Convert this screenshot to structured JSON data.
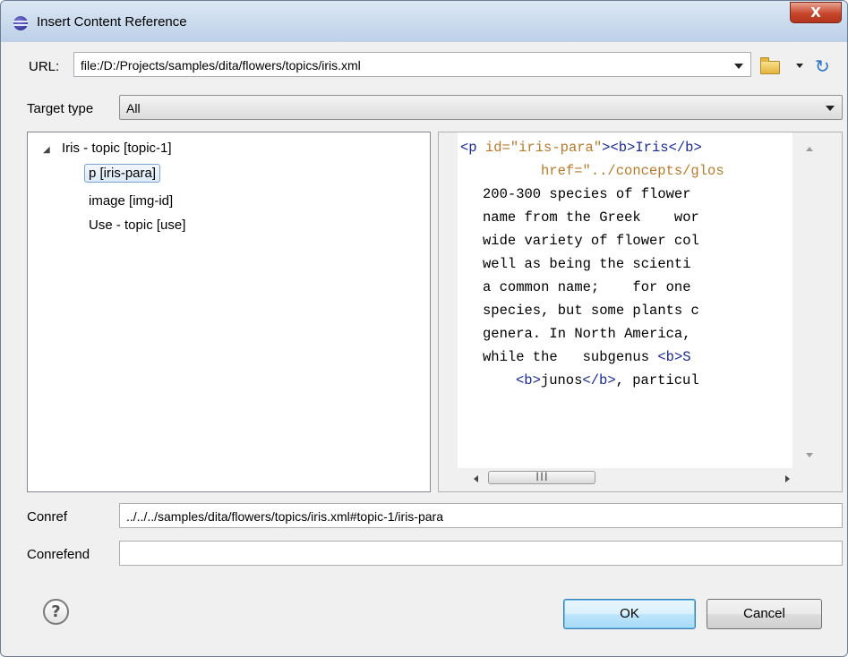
{
  "window": {
    "title": "Insert Content Reference",
    "close_glyph": "X"
  },
  "url": {
    "label": "URL:",
    "value": "file:/D:/Projects/samples/dita/flowers/topics/iris.xml"
  },
  "target_type": {
    "label": "Target type",
    "value": "All"
  },
  "tree": {
    "root": "Iris - topic [topic-1]",
    "children": [
      "p [iris-para]",
      "image [img-id]",
      "Use - topic [use]"
    ],
    "selected": "p [iris-para]"
  },
  "preview": {
    "line1": {
      "tag_open": "<p",
      "attr": " id=",
      "val": "\"iris-para\"",
      "rest": "><b>Iris</b> "
    },
    "line2": {
      "attr": "href=",
      "val": "\"../concepts/glos"
    },
    "lines": [
      "200-300 species of flower",
      "name from the Greek    wor",
      "wide variety of flower col",
      "well as being the scienti",
      "a common name;    for one ",
      "species, but some plants c",
      "genera. In North America, "
    ],
    "line10": {
      "text": "while the   subgenus ",
      "tag": "<b>S"
    },
    "line11": {
      "tag_open": "<b>",
      "text": "junos",
      "tag_close": "</b>",
      "rest": ", particul"
    }
  },
  "conref": {
    "label": "Conref",
    "value": "../../../samples/dita/flowers/topics/iris.xml#topic-1/iris-para"
  },
  "conrefend": {
    "label": "Conrefend",
    "value": ""
  },
  "buttons": {
    "help": "?",
    "ok": "OK",
    "cancel": "Cancel"
  },
  "icons": {
    "url_history": "chevron-down-icon",
    "browse": "folder-open-icon",
    "refresh": "refresh-icon",
    "help": "help-icon"
  }
}
